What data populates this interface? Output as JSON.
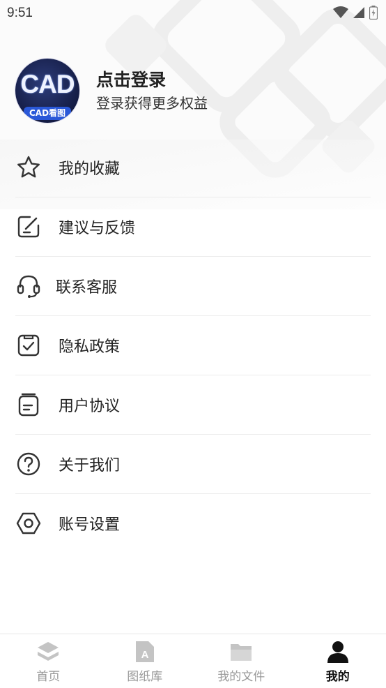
{
  "status_bar": {
    "time": "9:51"
  },
  "profile": {
    "avatar_text": "CAD",
    "avatar_badge": "CAD看图",
    "title": "点击登录",
    "subtitle": "登录获得更多权益"
  },
  "menu": {
    "items": [
      {
        "label": "我的收藏",
        "icon": "star-icon"
      },
      {
        "label": "建议与反馈",
        "icon": "edit-note-icon"
      },
      {
        "label": "联系客服",
        "icon": "headset-icon"
      },
      {
        "label": "隐私政策",
        "icon": "check-clipboard-icon"
      },
      {
        "label": "用户协议",
        "icon": "document-icon"
      },
      {
        "label": "关于我们",
        "icon": "question-circle-icon"
      },
      {
        "label": "账号设置",
        "icon": "hex-settings-icon"
      }
    ]
  },
  "tabbar": {
    "tabs": [
      {
        "label": "首页",
        "icon": "layers-icon",
        "active": false
      },
      {
        "label": "图纸库",
        "icon": "drawing-file-icon",
        "active": false
      },
      {
        "label": "我的文件",
        "icon": "folder-icon",
        "active": false
      },
      {
        "label": "我的",
        "icon": "person-icon",
        "active": true
      }
    ]
  },
  "colors": {
    "text": "#222222",
    "inactive_tab": "#999999",
    "active_tab": "#111111",
    "divider": "#ececec"
  }
}
